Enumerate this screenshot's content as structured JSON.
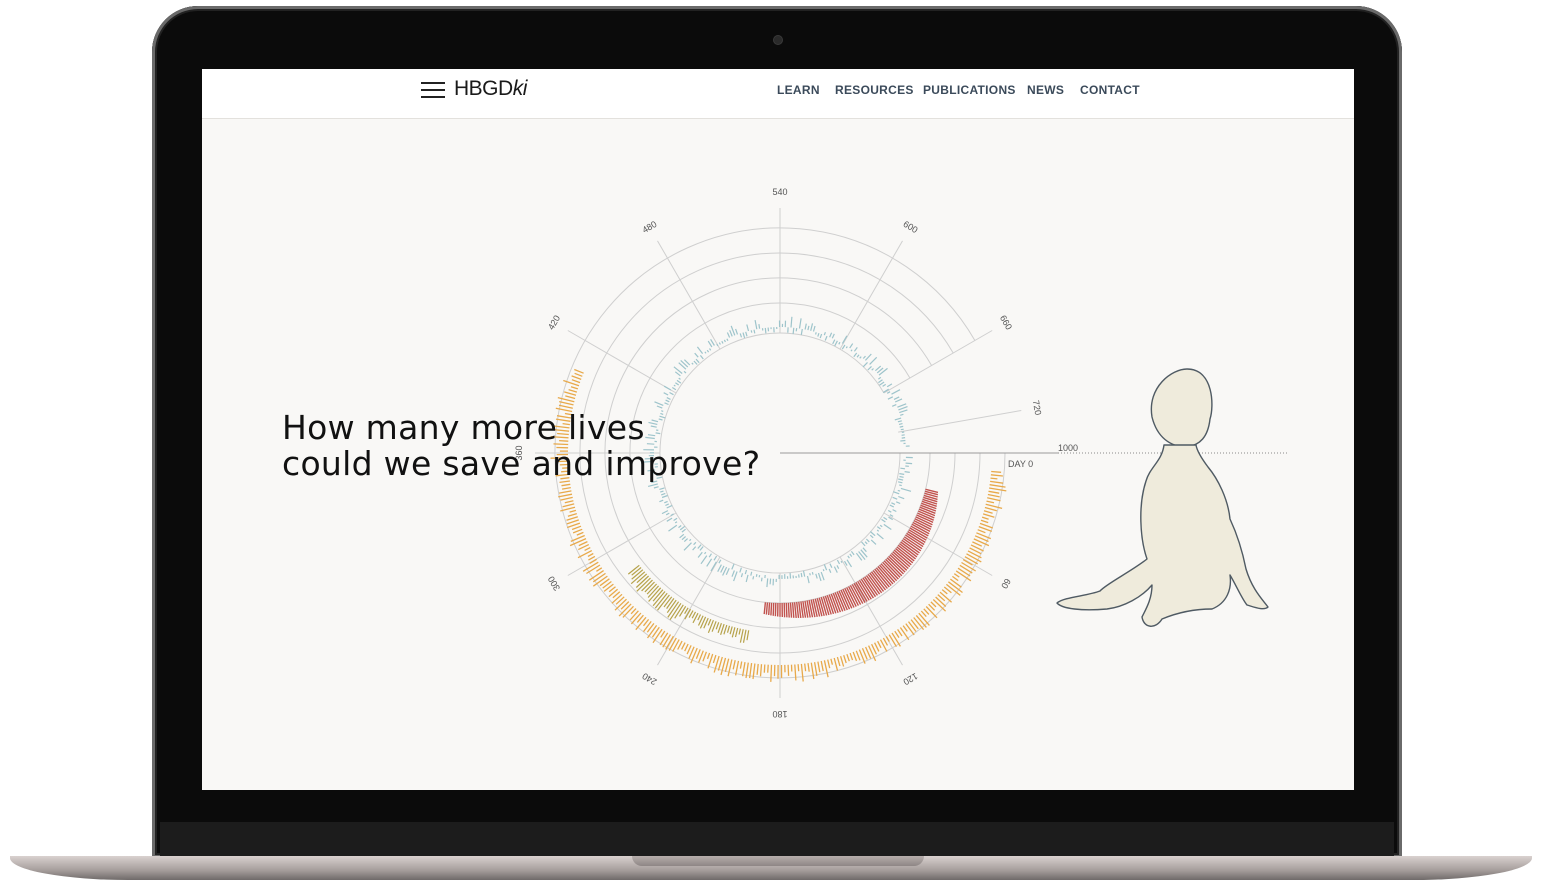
{
  "nav": {
    "logo_main": "HBGD",
    "logo_suffix": "ki",
    "links": [
      "LEARN",
      "RESOURCES",
      "PUBLICATIONS",
      "NEWS",
      "CONTACT"
    ]
  },
  "hero": {
    "headline_line1": "How many more lives",
    "headline_line2": "could we save and improve?"
  },
  "chart_data": {
    "type": "radial",
    "axis_ticks": [
      "60",
      "120",
      "180",
      "240",
      "300",
      "360",
      "420",
      "480",
      "540",
      "600",
      "660",
      "720",
      "1000"
    ],
    "start_label": "DAY 0",
    "colors": {
      "outer_ring": "#e8a94a",
      "inner_ring": "#9ec4cb",
      "red_band": "#c1524e",
      "olive_band": "#b6a24a",
      "grid": "#cfcfcf",
      "illustration_fill": "#efebdc",
      "illustration_stroke": "#4f5a63"
    }
  }
}
